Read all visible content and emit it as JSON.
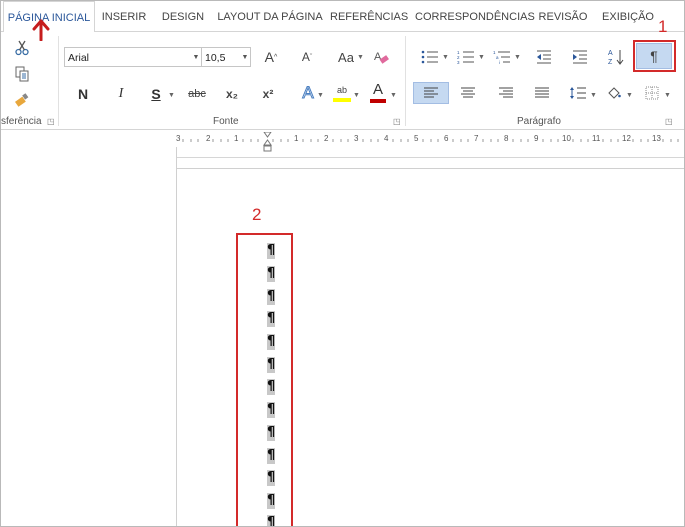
{
  "tabs": [
    "PÁGINA INICIAL",
    "INSERIR",
    "DESIGN",
    "LAYOUT DA PÁGINA",
    "REFERÊNCIAS",
    "CORRESPONDÊNCIAS",
    "REVISÃO",
    "EXIBIÇÃO"
  ],
  "clipboard": {
    "label": "Área de Transferência",
    "label_visible": "sferência"
  },
  "font": {
    "group_label": "Fonte",
    "name": "Arial",
    "size": "10,5",
    "bold": "N",
    "italic": "I",
    "underline": "S",
    "strike": "abc",
    "subscript": "x₂",
    "superscript": "x²",
    "grow": "A",
    "shrink": "A",
    "change_case": "Aa",
    "text_effects": "A",
    "highlight": "ab",
    "font_color": "A"
  },
  "paragraph": {
    "group_label": "Parágrafo",
    "show_marks": "¶",
    "sort": "A Z"
  },
  "annotations": {
    "num1": "1",
    "num2": "2"
  },
  "ruler_labels": [
    "3",
    "2",
    "1",
    "1",
    "2",
    "3",
    "4",
    "5",
    "6",
    "7",
    "8",
    "9",
    "10",
    "11",
    "12",
    "13"
  ],
  "pilcrow": "¶",
  "colors": {
    "accent": "#2b579a",
    "annotation_red": "#d32a2a",
    "pressed": "#c5d9f1"
  }
}
